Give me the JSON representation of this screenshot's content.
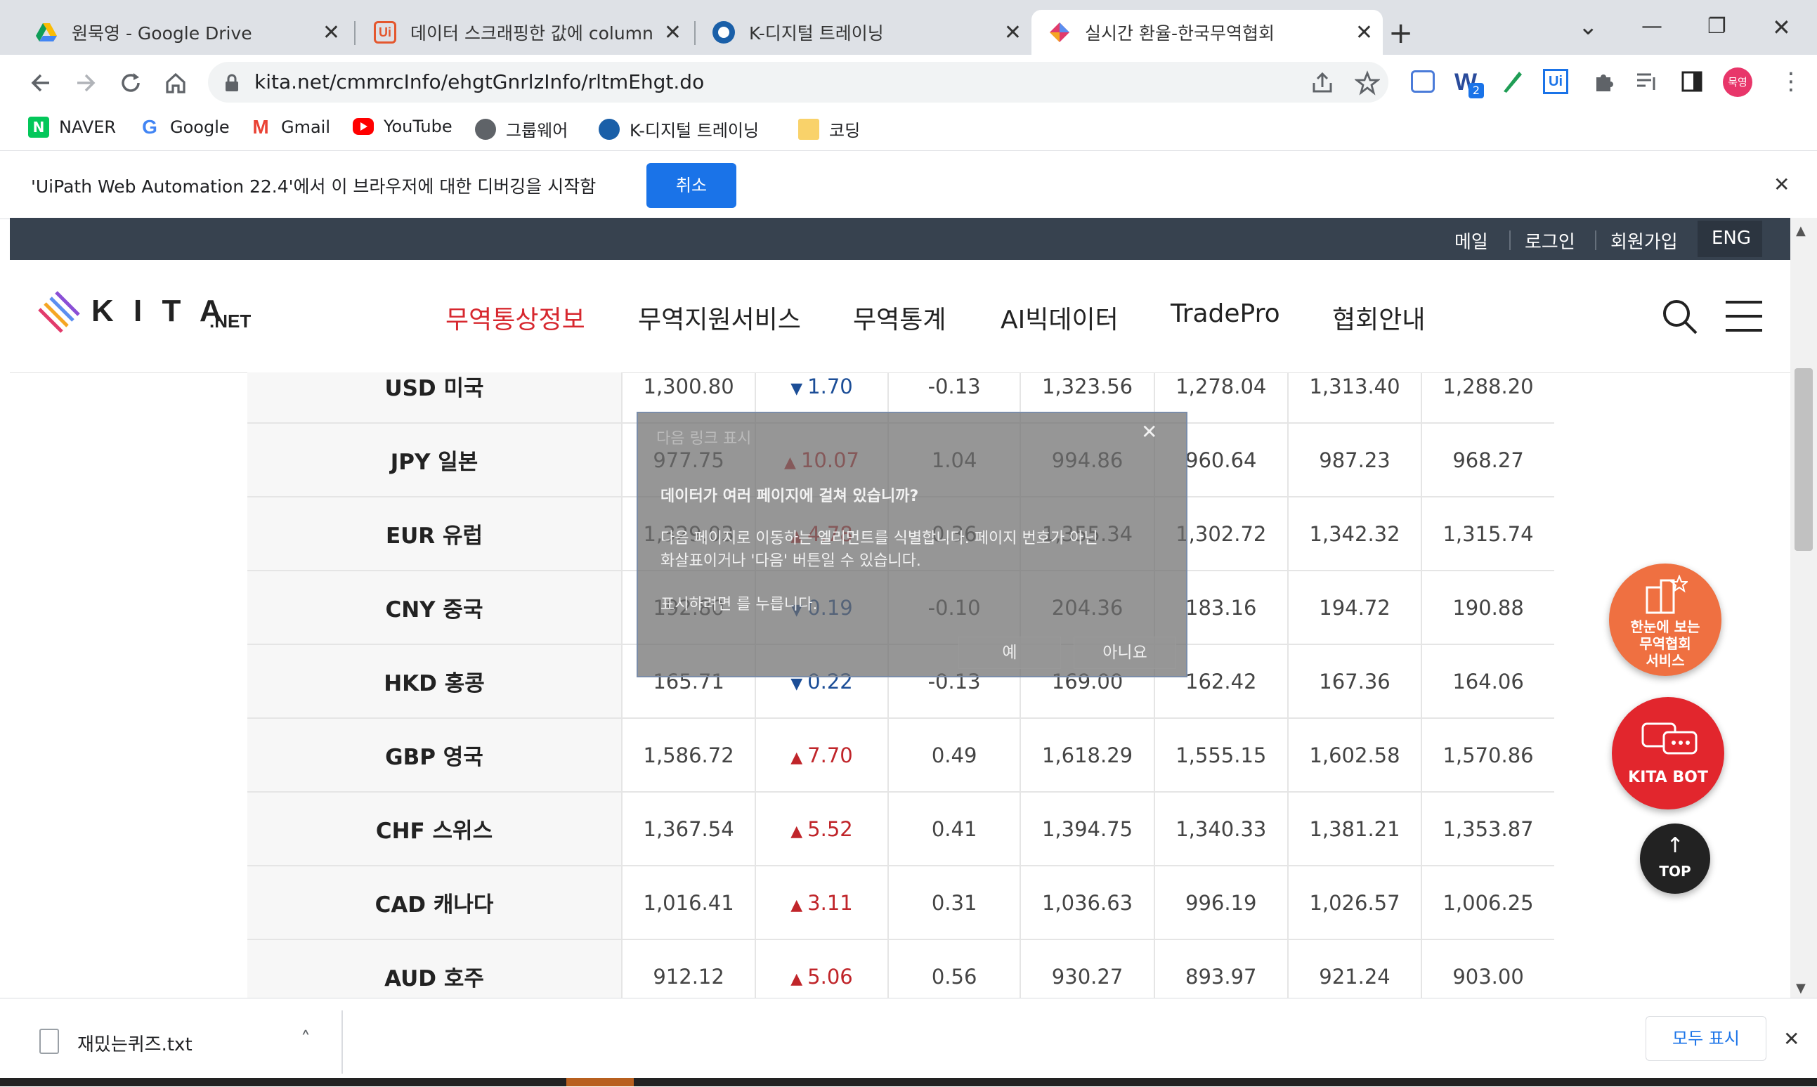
{
  "tabs": [
    {
      "title": "원묵영 - Google Drive",
      "close": "✕"
    },
    {
      "title": "데이터 스크래핑한 값에 column",
      "close": "✕"
    },
    {
      "title": "K-디지털 트레이닝",
      "close": "✕"
    },
    {
      "title": "실시간 환율-한국무역협회",
      "close": "✕"
    }
  ],
  "new_tab": "+",
  "window_controls": {
    "list": "⌄",
    "minimize": "—",
    "restore": "❐",
    "close": "✕"
  },
  "address": {
    "url": "kita.net/cmmrcInfo/ehgtGnrlzInfo/rltmEhgt.do"
  },
  "toolbar_badge": "2",
  "profile_label": "묵영",
  "bookmarks": [
    "NAVER",
    "Google",
    "Gmail",
    "YouTube",
    "그룹웨어",
    "K-디지털 트레이닝",
    "코딩"
  ],
  "infobar": {
    "message": "'UiPath Web Automation 22.4'에서 이 브라우저에 대한 디버깅을 시작함",
    "cancel": "취소",
    "close": "✕"
  },
  "util_links": [
    "메일",
    "로그인",
    "회원가입",
    "ENG"
  ],
  "logo_text": "K I T A",
  "logo_suffix": ".NET",
  "menu": [
    "무역통상정보",
    "무역지원서비스",
    "무역통계",
    "AI빅데이터",
    "TradePro",
    "협회안내"
  ],
  "rates": [
    {
      "cur": "USD 미국",
      "base": "1,300.80",
      "dir": "down",
      "chg": "1.70",
      "pct": "-0.13",
      "c1": "1,323.56",
      "c2": "1,278.04",
      "c3": "1,313.40",
      "c4": "1,288.20"
    },
    {
      "cur": "JPY 일본",
      "base": "977.75",
      "dir": "up",
      "chg": "10.07",
      "pct": "1.04",
      "c1": "994.86",
      "c2": "960.64",
      "c3": "987.23",
      "c4": "968.27"
    },
    {
      "cur": "EUR 유럽",
      "base": "1,329.03",
      "dir": "up",
      "chg": "4.78",
      "pct": "0.36",
      "c1": "1,355.34",
      "c2": "1,302.72",
      "c3": "1,342.32",
      "c4": "1,315.74"
    },
    {
      "cur": "CNY 중국",
      "base": "192.80",
      "dir": "down",
      "chg": "0.19",
      "pct": "-0.10",
      "c1": "204.36",
      "c2": "183.16",
      "c3": "194.72",
      "c4": "190.88"
    },
    {
      "cur": "HKD 홍콩",
      "base": "165.71",
      "dir": "down",
      "chg": "0.22",
      "pct": "-0.13",
      "c1": "169.00",
      "c2": "162.42",
      "c3": "167.36",
      "c4": "164.06"
    },
    {
      "cur": "GBP 영국",
      "base": "1,586.72",
      "dir": "up",
      "chg": "7.70",
      "pct": "0.49",
      "c1": "1,618.29",
      "c2": "1,555.15",
      "c3": "1,602.58",
      "c4": "1,570.86"
    },
    {
      "cur": "CHF 스위스",
      "base": "1,367.54",
      "dir": "up",
      "chg": "5.52",
      "pct": "0.41",
      "c1": "1,394.75",
      "c2": "1,340.33",
      "c3": "1,381.21",
      "c4": "1,353.87"
    },
    {
      "cur": "CAD 캐나다",
      "base": "1,016.41",
      "dir": "up",
      "chg": "3.11",
      "pct": "0.31",
      "c1": "1,036.63",
      "c2": "996.19",
      "c3": "1,026.57",
      "c4": "1,006.25"
    },
    {
      "cur": "AUD 호주",
      "base": "912.12",
      "dir": "up",
      "chg": "5.06",
      "pct": "0.56",
      "c1": "930.27",
      "c2": "893.97",
      "c3": "921.24",
      "c4": "903.00"
    }
  ],
  "modal": {
    "title": "다음 링크 표시",
    "heading": "데이터가 여러 페이지에 걸쳐 있습니까?",
    "body1": "다음 페이지로 이동하는 엘리먼트를 식별합니다. 페이지 번호가 아닌",
    "body2": "화살표이거나 '다음' 버튼일 수 있습니다.",
    "body3": "표시하려면 를 누릅니다.",
    "yes": "예",
    "no": "아니요",
    "close": "✕"
  },
  "fabs": {
    "service": [
      "한눈에 보는",
      "무역협회",
      "서비스"
    ],
    "bot": "KITA BOT",
    "top": "TOP"
  },
  "download": {
    "file": "재밌는퀴즈.txt",
    "show_all": "모두 표시",
    "close": "✕"
  },
  "colors": {
    "accent_red": "#c0252a",
    "down_blue": "#1c4e97",
    "util_bar": "#37424f",
    "chrome_blue": "#1a73e8",
    "menu_active": "#d7282f"
  }
}
